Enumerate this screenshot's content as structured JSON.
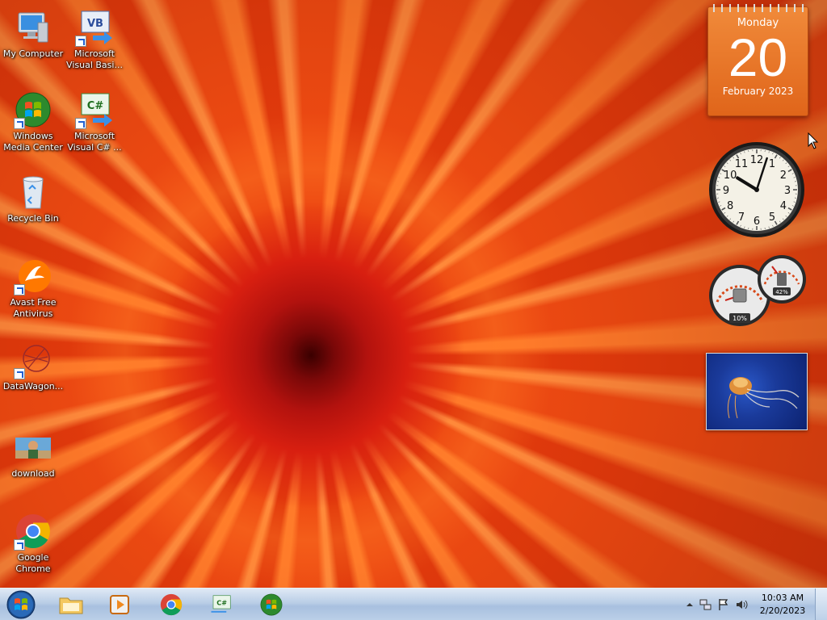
{
  "desktop": {
    "icons": [
      {
        "label": "My Computer",
        "icon": "computer-icon",
        "shortcut": false
      },
      {
        "label": "Microsoft Visual Basi...",
        "icon": "visual-basic-icon",
        "shortcut": true
      },
      {
        "label": "Windows Media Center",
        "icon": "media-center-icon",
        "shortcut": true
      },
      {
        "label": "Microsoft Visual C# ...",
        "icon": "visual-csharp-icon",
        "shortcut": true
      },
      {
        "label": "Recycle Bin",
        "icon": "recycle-bin-icon",
        "shortcut": false
      },
      {
        "label": "Avast Free Antivirus",
        "icon": "avast-icon",
        "shortcut": true
      },
      {
        "label": "DataWagon...",
        "icon": "datawagon-icon",
        "shortcut": true
      },
      {
        "label": "download",
        "icon": "image-file-icon",
        "shortcut": false
      },
      {
        "label": "Google Chrome",
        "icon": "chrome-icon",
        "shortcut": true
      }
    ]
  },
  "gadgets": {
    "calendar": {
      "weekday": "Monday",
      "day": "20",
      "month_year": "February 2023"
    },
    "clock": {
      "numerals": [
        "12",
        "1",
        "2",
        "3",
        "4",
        "5",
        "6",
        "7",
        "8",
        "9",
        "10",
        "11"
      ],
      "hour": 10,
      "minute": 3
    },
    "meters": {
      "cpu_percent": "10%",
      "memory_percent": "42%"
    },
    "slideshow": {
      "subject": "jellyfish-photo"
    }
  },
  "taskbar": {
    "start": "windows-start-orb",
    "pinned": [
      {
        "name": "windows-explorer-icon"
      },
      {
        "name": "media-player-icon"
      },
      {
        "name": "chrome-icon"
      },
      {
        "name": "visual-csharp-icon"
      },
      {
        "name": "media-center-icon"
      }
    ],
    "tray": {
      "time": "10:03 AM",
      "date": "2/20/2023"
    }
  },
  "colors": {
    "wallpaper": "#e8440f",
    "taskbar": "#b9cde6",
    "calendar": "#e8752a"
  }
}
